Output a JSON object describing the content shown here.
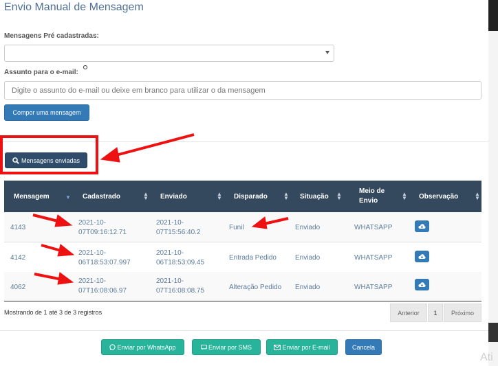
{
  "title": "Envio Manual de Mensagem",
  "form": {
    "pre_label": "Mensagens Pré cadastradas:",
    "subject_label": "Assunto para o e-mail:",
    "subject_placeholder": "Digite o assunto do e-mail ou deixe em branco para utilizar o da mensagem",
    "compose_button": "Compor uma mensagem"
  },
  "sent_button": "Mensagens enviadas",
  "table": {
    "headers": [
      "Mensagem",
      "Cadastrado",
      "Enviado",
      "Disparado",
      "Situação",
      "Meio de Envio",
      "Observação"
    ],
    "rows": [
      {
        "id": "4143",
        "cadastrado_1": "2021-10-",
        "cadastrado_2": "07T09:16:12.71",
        "enviado_1": "2021-10-",
        "enviado_2": "07T15:56:40.2",
        "disparado": "Funil",
        "situacao": "Enviado",
        "meio": "WHATSAPP"
      },
      {
        "id": "4142",
        "cadastrado_1": "2021-10-",
        "cadastrado_2": "06T18:53:07.997",
        "enviado_1": "2021-10-",
        "enviado_2": "06T18:53:09.45",
        "disparado": "Entrada Pedido",
        "situacao": "Enviado",
        "meio": "WHATSAPP"
      },
      {
        "id": "4062",
        "cadastrado_1": "2021-10-",
        "cadastrado_2": "07T16:08:06.97",
        "enviado_1": "2021-10-",
        "enviado_2": "07T16:08:08.75",
        "disparado": "Alteração Pedido",
        "situacao": "Enviado",
        "meio": "WHATSAPP"
      }
    ]
  },
  "info": "Mostrando de 1 até 3 de 3 registros",
  "pagination": {
    "prev": "Anterior",
    "page": "1",
    "next": "Próximo"
  },
  "footer": {
    "whatsapp": "Enviar por WhatsApp",
    "sms": "Enviar por SMS",
    "email": "Enviar por E-mail",
    "cancel": "Cancela"
  },
  "watermark": "Ati",
  "colors": {
    "primary": "#337ab7",
    "header": "#34495e",
    "success": "#27b49b",
    "annotation": "#ee1111"
  }
}
